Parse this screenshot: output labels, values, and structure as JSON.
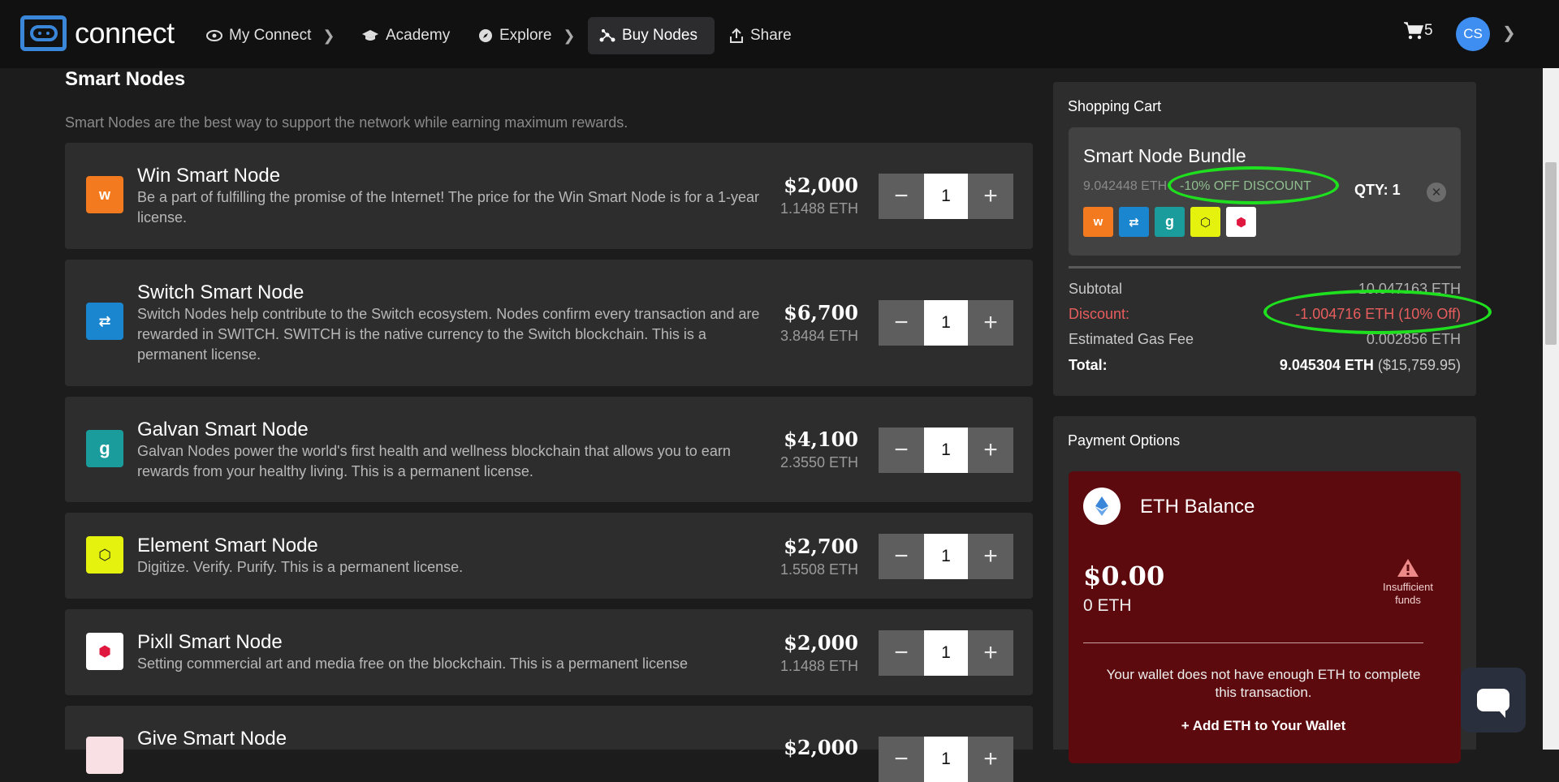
{
  "nav": {
    "logo_text": "connect",
    "items": [
      {
        "label": "My Connect"
      },
      {
        "label": "Academy"
      },
      {
        "label": "Explore"
      },
      {
        "label": "Buy Nodes"
      },
      {
        "label": "Share"
      }
    ],
    "cart_count": "5",
    "avatar_initials": "CS"
  },
  "section": {
    "title": "Smart Nodes",
    "subtitle": "Smart Nodes are the best way to support the network while earning maximum rewards."
  },
  "nodes": [
    {
      "name": "Win Smart Node",
      "desc": "Be a part of fulfilling the promise of the Internet! The price for the Win Smart Node is for a 1-year license.",
      "price": "$2,000",
      "eth": "1.1488 ETH",
      "qty": "1",
      "icon_glyph": "w",
      "icon_color": "#f47a1f",
      "icon_fg": "#ffffff"
    },
    {
      "name": "Switch Smart Node",
      "desc": "Switch Nodes help contribute to the Switch ecosystem. Nodes confirm every transaction and are rewarded in SWITCH. SWITCH is the native currency to the Switch blockchain. This is a permanent license.",
      "price": "$6,700",
      "eth": "3.8484 ETH",
      "qty": "1",
      "icon_glyph": "⇄",
      "icon_color": "#1a86d0",
      "icon_fg": "#ffffff"
    },
    {
      "name": "Galvan Smart Node",
      "desc": "Galvan Nodes power the world's first health and wellness blockchain that allows you to earn rewards from your healthy living. This is a permanent license.",
      "price": "$4,100",
      "eth": "2.3550 ETH",
      "qty": "1",
      "icon_glyph": "g",
      "icon_color": "#1a9c9c",
      "icon_fg": "#ffffff"
    },
    {
      "name": "Element Smart Node",
      "desc": "Digitize. Verify. Purify. This is a permanent license.",
      "price": "$2,700",
      "eth": "1.5508 ETH",
      "qty": "1",
      "icon_glyph": "⬡",
      "icon_color": "#e4f20e",
      "icon_fg": "#222222"
    },
    {
      "name": "Pixll Smart Node",
      "desc": "Setting commercial art and media free on the blockchain. This is a permanent license",
      "price": "$2,000",
      "eth": "1.1488 ETH",
      "qty": "1",
      "icon_glyph": "⬢",
      "icon_color": "#ffffff",
      "icon_fg": "#e01840"
    },
    {
      "name": "Give Smart Node",
      "desc": "",
      "price": "$2,000",
      "eth": "",
      "qty": "1",
      "icon_glyph": "",
      "icon_color": "#f8e0e4",
      "icon_fg": "#e01840"
    }
  ],
  "cart": {
    "title": "Shopping Cart",
    "bundle_name": "Smart Node Bundle",
    "bundle_eth": "9.042448 ETH",
    "bundle_discount": "-10% OFF DISCOUNT",
    "bundle_qty": "QTY: 1",
    "remove_glyph": "✕",
    "subtotal_label": "Subtotal",
    "subtotal_value": "10.047163 ETH",
    "discount_label": "Discount:",
    "discount_value": "-1.004716 ETH (10% Off)",
    "gas_label": "Estimated Gas Fee",
    "gas_value": "0.002856 ETH",
    "total_label": "Total:",
    "total_eth": "9.045304 ETH",
    "total_usd": "($15,759.95)"
  },
  "payment": {
    "title": "Payment Options",
    "method": "ETH Balance",
    "usd": "$0.00",
    "eth": "0 ETH",
    "warning": "Insufficient funds",
    "message": "Your wallet does not have enough ETH to complete this transaction.",
    "add_link": "+ Add ETH to Your Wallet"
  },
  "colors": {
    "accent": "#3a86d8",
    "discount_red": "#e85d5d",
    "highlight_green": "#1fe01f",
    "payment_bg": "#5c0a0d"
  }
}
